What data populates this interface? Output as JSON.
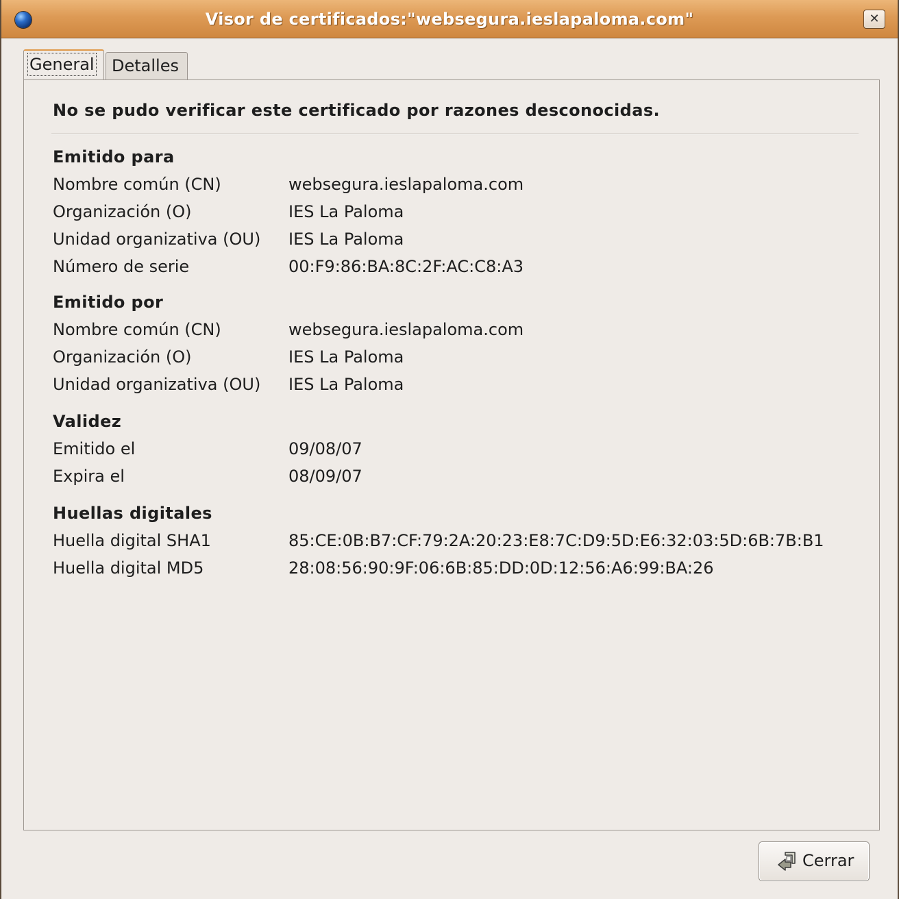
{
  "window": {
    "title": "Visor de certificados:\"websegura.ieslapaloma.com\"",
    "close_glyph": "✕",
    "icon": "globe-icon"
  },
  "tabs": [
    {
      "label": "General",
      "active": true
    },
    {
      "label": "Detalles",
      "active": false
    }
  ],
  "general": {
    "warning": "No se pudo verificar este certificado por razones desconocidas.",
    "issued_to": {
      "title": "Emitido para",
      "rows": [
        {
          "label": "Nombre común (CN)",
          "value": "websegura.ieslapaloma.com"
        },
        {
          "label": "Organización (O)",
          "value": "IES La Paloma"
        },
        {
          "label": "Unidad organizativa (OU)",
          "value": "IES La Paloma"
        },
        {
          "label": "Número de serie",
          "value": "00:F9:86:BA:8C:2F:AC:C8:A3"
        }
      ]
    },
    "issued_by": {
      "title": "Emitido por",
      "rows": [
        {
          "label": "Nombre común (CN)",
          "value": "websegura.ieslapaloma.com"
        },
        {
          "label": "Organización (O)",
          "value": "IES La Paloma"
        },
        {
          "label": "Unidad organizativa (OU)",
          "value": "IES La Paloma"
        }
      ]
    },
    "validity": {
      "title": "Validez",
      "rows": [
        {
          "label": "Emitido el",
          "value": "09/08/07"
        },
        {
          "label": "Expira el",
          "value": "08/09/07"
        }
      ]
    },
    "fingerprints": {
      "title": "Huellas digitales",
      "rows": [
        {
          "label": "Huella digital SHA1",
          "value": "85:CE:0B:B7:CF:79:2A:20:23:E8:7C:D9:5D:E6:32:03:5D:6B:7B:B1"
        },
        {
          "label": "Huella digital MD5",
          "value": "28:08:56:90:9F:06:6B:85:DD:0D:12:56:A6:99:BA:26"
        }
      ]
    }
  },
  "buttons": {
    "close_label": "Cerrar",
    "close_icon": "close-door-icon"
  },
  "colors": {
    "titlebar": "#dd9a55",
    "background": "#efebe7",
    "tab_highlight": "#e09a4a"
  }
}
